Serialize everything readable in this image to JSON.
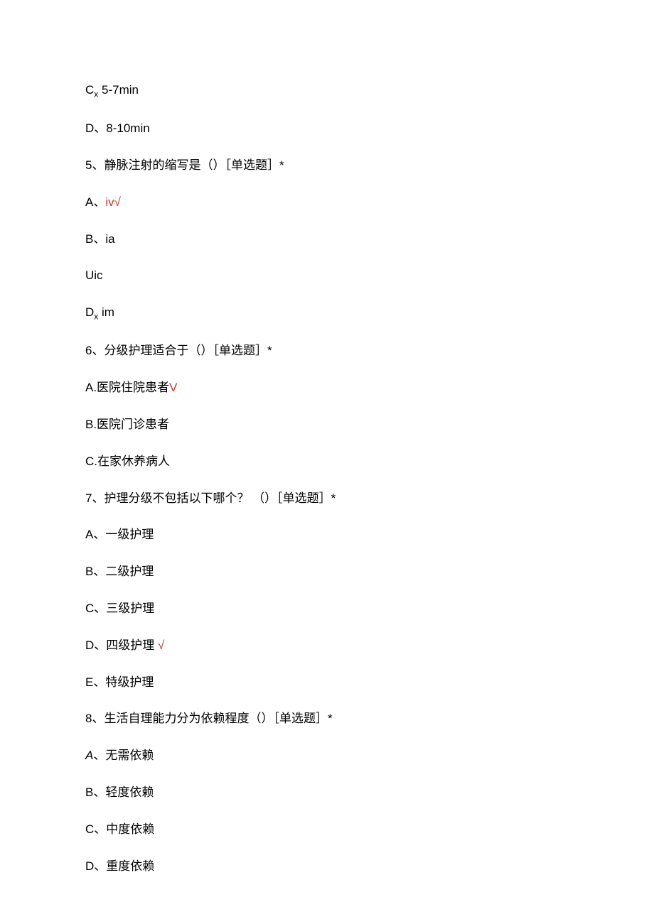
{
  "lines": {
    "l1_a": "C",
    "l1_b": "x",
    "l1_c": " 5-7min",
    "l2": "D、8-10min",
    "l3": "5、静脉注射的缩写是（）［单选题］*",
    "l4_a": "A、",
    "l4_b": "iv√",
    "l5": "B、ia",
    "l6": "Uic",
    "l7_a": "D",
    "l7_b": "x",
    "l7_c": " im",
    "l8": "6、分级护理适合于（）［单选题］*",
    "l9_a": "A.医院住院患者",
    "l9_b": "V",
    "l10": "B.医院门诊患者",
    "l11": "C.在家休养病人",
    "l12": "7、护理分级不包括以下哪个？ （）［单选题］*",
    "l13": "A、一级护理",
    "l14": "B、二级护理",
    "l15": "C、三级护理",
    "l16_a": "D、四级护理 ",
    "l16_b": "√",
    "l17": "E、特级护理",
    "l18": "8、生活自理能力分为依赖程度（）［单选题］*",
    "l19_a": "A",
    "l19_b": "、无需依赖",
    "l20": "B、轻度依赖",
    "l21": "C、中度依赖",
    "l22": "D、重度依赖"
  }
}
